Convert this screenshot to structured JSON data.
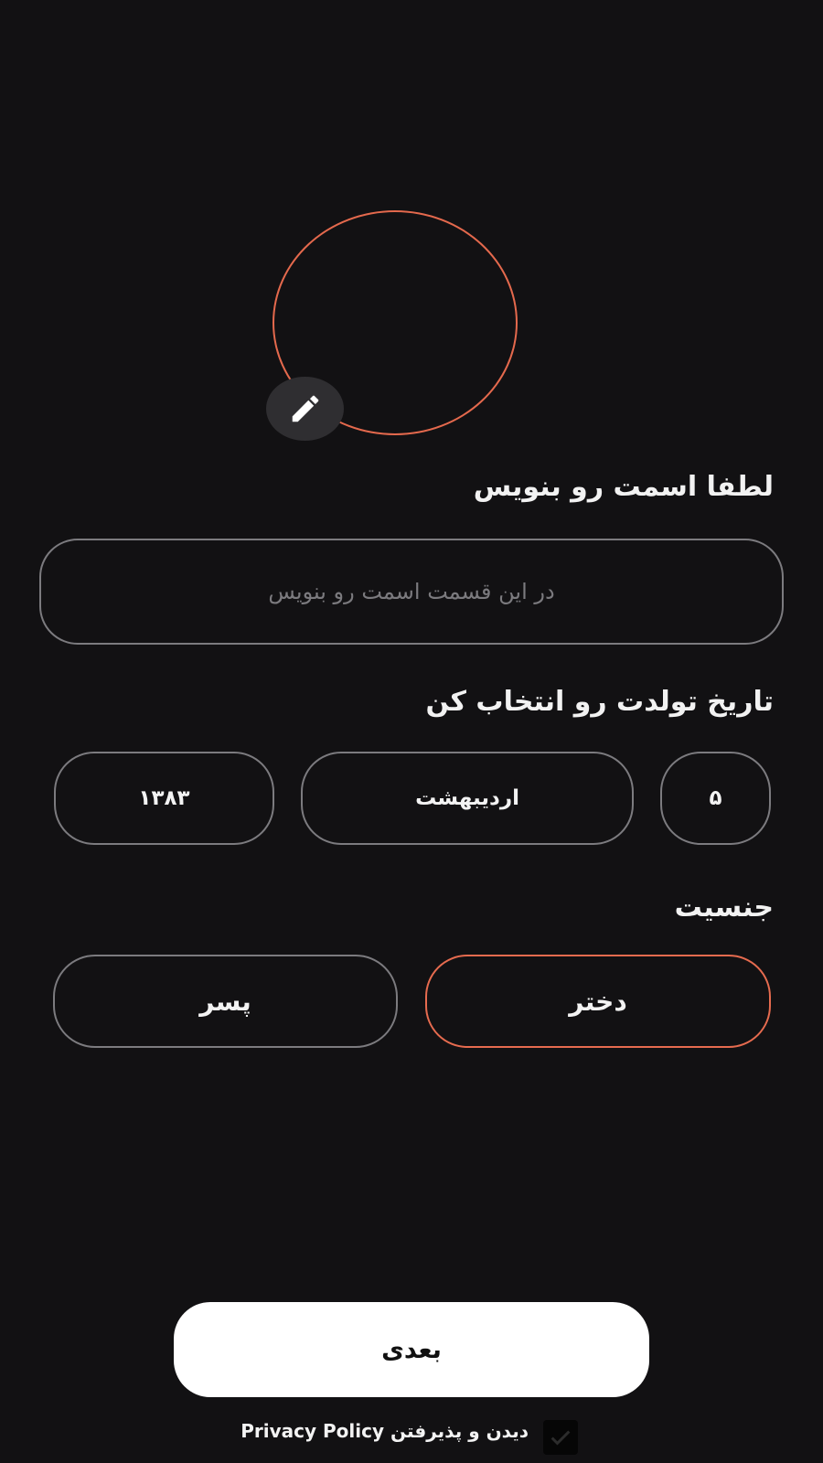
{
  "profile": {
    "avatar_border_color": "#e4694d",
    "edit_icon": "pencil-icon"
  },
  "name_section": {
    "label": "لطفا اسمت رو بنویس",
    "placeholder": "در این قسمت اسمت رو بنویس",
    "value": ""
  },
  "birthdate_section": {
    "label": "تاریخ تولدت رو انتخاب کن",
    "day": "۵",
    "month": "اردیبهشت",
    "year": "۱۳۸۳"
  },
  "gender_section": {
    "label": "جنسیت",
    "options": [
      "دختر",
      "پسر"
    ],
    "selected": "دختر",
    "selected_color": "#e66b4f"
  },
  "actions": {
    "next_label": "بعدی",
    "policy_text": "دیدن و پذیرفتن Privacy Policy",
    "checkbox_icon": "check-icon"
  }
}
